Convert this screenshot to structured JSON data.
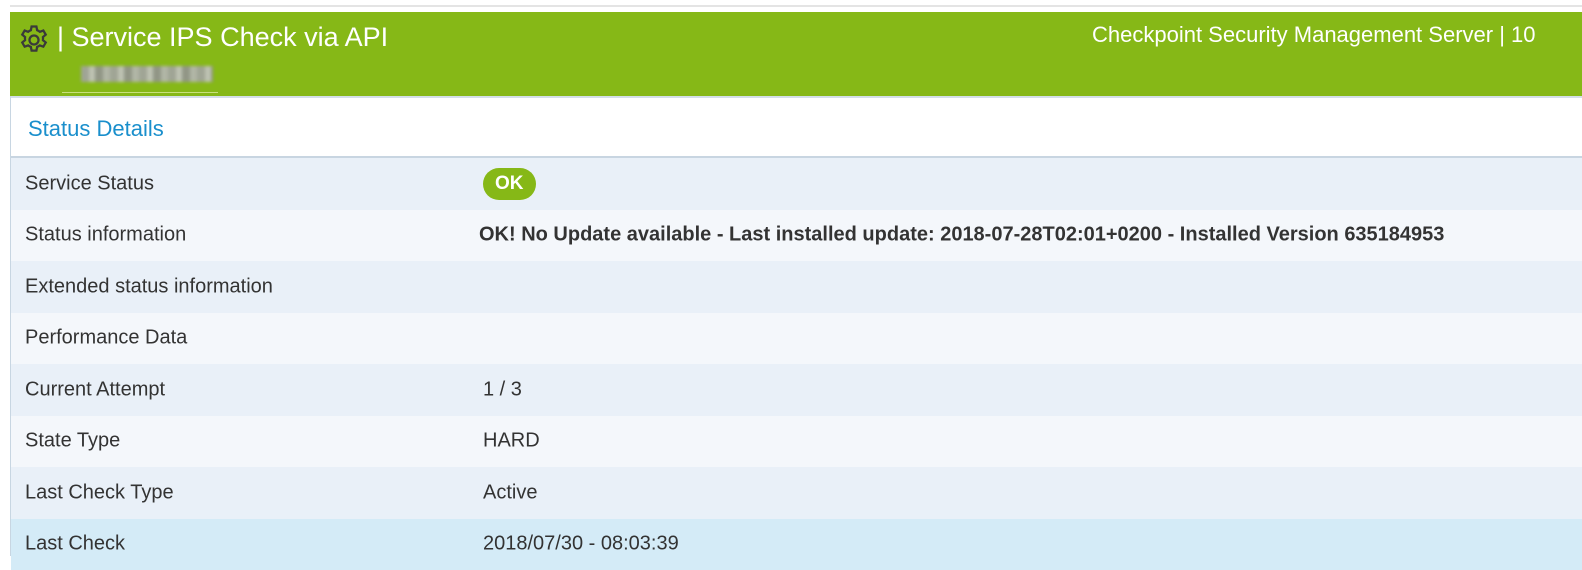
{
  "header": {
    "title": "| Service IPS Check via API",
    "host": "Checkpoint Security Management Server | 10",
    "icon": "gear-icon",
    "background": "#86b817"
  },
  "panel": {
    "title": "Status Details",
    "title_color": "#1a8fcc"
  },
  "rows": [
    {
      "label": "Service Status",
      "value": "OK"
    },
    {
      "label": "Status information",
      "value": "OK! No Update available - Last installed update: 2018-07-28T02:01+0200 - Installed Version 635184953"
    },
    {
      "label": "Extended status information",
      "value": ""
    },
    {
      "label": "Performance Data",
      "value": ""
    },
    {
      "label": "Current Attempt",
      "value": "1 / 3"
    },
    {
      "label": "State Type",
      "value": "HARD"
    },
    {
      "label": "Last Check Type",
      "value": "Active"
    },
    {
      "label": "Last Check",
      "value": "2018/07/30 - 08:03:39"
    }
  ],
  "status_colors": {
    "ok": "#86b817"
  }
}
